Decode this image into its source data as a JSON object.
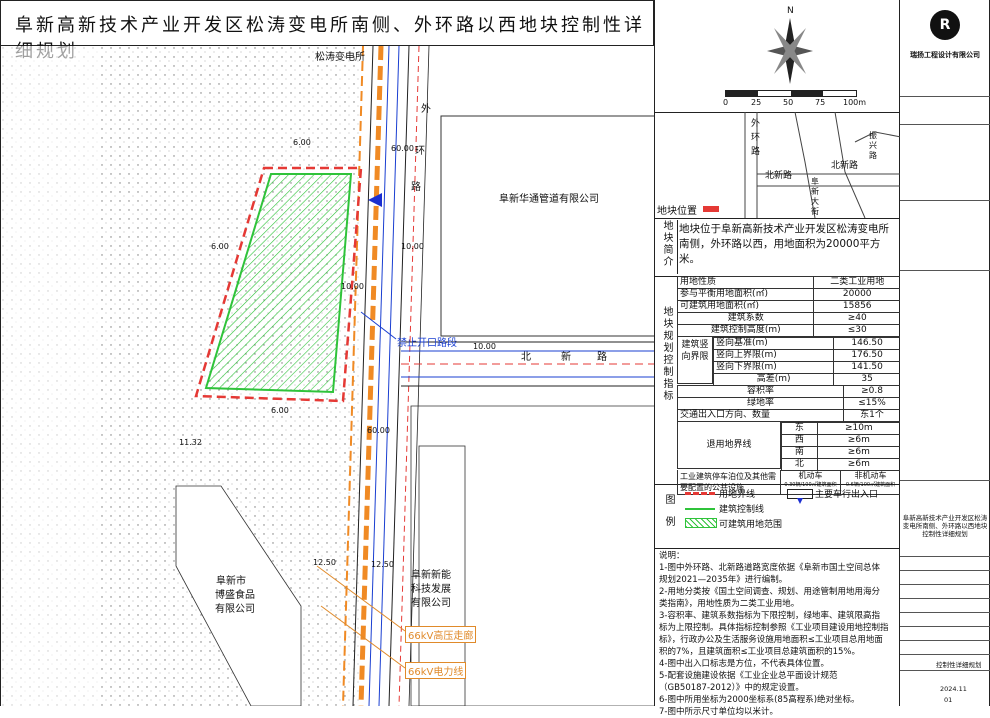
{
  "title": "阜新高新技术产业开发区松涛变电所南侧、外环路以西地块控制性详细规划",
  "map": {
    "substation": "松涛变电所",
    "road_waihuan": [
      "外",
      "环",
      "路"
    ],
    "road_beixin": [
      "北",
      "新",
      "路"
    ],
    "company_huatong": "阜新华通管道有限公司",
    "company_bosheng": [
      "阜新市",
      "博盛食品",
      "有限公司"
    ],
    "company_xinneng": [
      "阜新新能",
      "科技发展",
      "有限公司"
    ],
    "no_entry_label": "禁止开口路段",
    "hv_corridor": "66kV高压走廊",
    "power_line": "66kV电力线",
    "dims": {
      "d1": "6.00",
      "d2": "6.00",
      "d3": "6.00",
      "d4": "10.00",
      "d5": "60.00",
      "d6": "60.00",
      "d7": "10.00",
      "d8": "11.32",
      "d9": "12.50",
      "d10": "12.50",
      "d11": "60.00",
      "d12": "10.00"
    }
  },
  "compass": {
    "north": "N",
    "scale": [
      "0",
      "25",
      "50",
      "75",
      "100m"
    ]
  },
  "location": {
    "label": "地块位置",
    "roads": {
      "w1": "外",
      "w2": "环",
      "w3": "路",
      "bx": "北新路",
      "fk": [
        "阜",
        "新",
        "大",
        "街"
      ],
      "zz": [
        "振",
        "兴",
        "路"
      ],
      "bx2": "北新路"
    }
  },
  "intro": {
    "header": "地块简介",
    "text": "地块位于阜新高新技术产业开发区松涛变电所南侧，外环路以西，用地面积为20000平方米。"
  },
  "indicators": {
    "header": "地块规划控制指标",
    "rows": [
      [
        "用地性质",
        "二类工业用地"
      ],
      [
        "参与平衡用地面积(㎡)",
        "20000"
      ],
      [
        "可建筑用地面积(㎡)",
        "15856"
      ],
      [
        "建筑系数",
        "≥40"
      ],
      [
        "建筑控制高度(m)",
        "≤30"
      ]
    ],
    "vertical_group": "建筑竖向界限",
    "vertical_rows": [
      [
        "竖向基准(m)",
        "146.50"
      ],
      [
        "竖向上界限(m)",
        "176.50"
      ],
      [
        "竖向下界限(m)",
        "141.50"
      ],
      [
        "高差(m)",
        "35"
      ]
    ],
    "rows2": [
      [
        "容积率",
        "≥0.8"
      ],
      [
        "绿地率",
        "≤15%"
      ],
      [
        "交通出入口方向、数量",
        "东1个"
      ]
    ],
    "setback_label": "退用地界线",
    "setbacks": [
      [
        "东",
        "≥10m"
      ],
      [
        "西",
        "≥6m"
      ],
      [
        "南",
        "≥6m"
      ],
      [
        "北",
        "≥6m"
      ]
    ],
    "parking_label": "工业建筑停车泊位及其他需要配置的公共设施",
    "parking_cols": [
      "机动车",
      "非机动车"
    ],
    "parking_vals": [
      "0.30辆/100㎡建筑面积",
      "0.6辆/100㎡建筑面积"
    ]
  },
  "legend": {
    "header": "图例",
    "items": [
      "用地界线",
      "主要车行出入口",
      "建筑控制线",
      "可建筑用地范围"
    ]
  },
  "notes": {
    "header": "说明：",
    "lines": [
      "1-图中外环路、北新路道路宽度依据《阜新市国土空间总体",
      "规划2021—2035年》进行编制。",
      "2-用地分类按《国土空间调查、规划、用途管制用地用海分",
      "类指南》，用地性质为二类工业用地。",
      "3-容积率、建筑系数指标为下限控制，绿地率、建筑限高指",
      "标为上限控制。具体指标控制参照《工业项目建设用地控制指",
      "标》，行政办公及生活服务设施用地面积≤工业项目总用地面",
      "积的7%，且建筑面积≤工业项目总建筑面积的15%。",
      "4-图中出入口标志是方位，不代表具体位置。",
      "5-配套设施建设依据《工业企业总平面设计规范",
      "（GB50187-2012）》中的规定设置。",
      "6-图中所用坐标为2000坐标系(85高程系)绝对坐标。",
      "7-图中所示尺寸单位均以米计。"
    ]
  },
  "sheet": {
    "company": "瑞扬工程设计有限公司",
    "project_caption": "阜新高新技术产业开发区松涛变电所南侧、外环路以西地块控制性详细规划",
    "drawing_name": "控制性详细规划",
    "date": "2024.11",
    "number": "01"
  },
  "colors": {
    "boundary": "#e53935",
    "road_orange": "#f08a24",
    "road_blue": "#1a3fd1",
    "green": "#2fc33a",
    "arrow": "#1b2fd1",
    "hv": "#e08a2a"
  }
}
